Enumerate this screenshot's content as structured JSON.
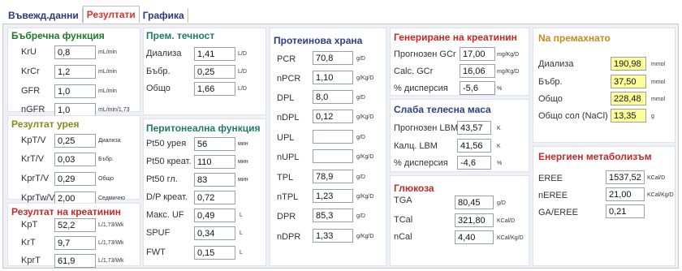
{
  "tabs": {
    "entry": "Въвежд.данни",
    "results": "Резултати",
    "graphics": "Графика"
  },
  "kidney": {
    "title": "Бъбречна функция",
    "rows": [
      {
        "label": "KrU",
        "value": "0,8",
        "unit": "mL/min"
      },
      {
        "label": "KrCr",
        "value": "1,2",
        "unit": "mL/min"
      },
      {
        "label": "GFR",
        "value": "1,0",
        "unit": "mL/min"
      },
      {
        "label": "nGFR",
        "value": "1,0",
        "unit": "mL/min/1,73"
      }
    ]
  },
  "urea": {
    "title": "Резултат урея",
    "rows": [
      {
        "label": "KpT/V",
        "value": "0,25",
        "unit": "Диализа"
      },
      {
        "label": "KrT/V",
        "value": "0,03",
        "unit": "Бъбр."
      },
      {
        "label": "KprT/V",
        "value": "0,29",
        "unit": "Общо"
      },
      {
        "label": "KprTw/V",
        "value": "2,00",
        "unit": "Седмично"
      }
    ]
  },
  "creat": {
    "title": "Резултат на креатинин",
    "rows": [
      {
        "label": "KpT",
        "value": "52,2",
        "unit": "L/1,73/Wk"
      },
      {
        "label": "KrT",
        "value": "9,7",
        "unit": "L/1,73/Wk"
      },
      {
        "label": "KprT",
        "value": "61,9",
        "unit": "L/1,73/Wk"
      }
    ]
  },
  "fluid": {
    "title": "Прем. течност",
    "rows": [
      {
        "label": "Диализа",
        "value": "1,41",
        "unit": "L/D"
      },
      {
        "label": "Бъбр.",
        "value": "0,25",
        "unit": "L/D"
      },
      {
        "label": "Общо",
        "value": "1,66",
        "unit": "L/D"
      }
    ]
  },
  "peritoneal": {
    "title": "Перитонеална функция",
    "rows": [
      {
        "label": "Pt50 урея",
        "value": "56",
        "unit": "мин"
      },
      {
        "label": "Pt50 креат.",
        "value": "110",
        "unit": "мин"
      },
      {
        "label": "Pt50 гл.",
        "value": "83",
        "unit": "мин"
      },
      {
        "label": "D/P креат.",
        "value": "0,72",
        "unit": ""
      },
      {
        "label": "Макс. UF",
        "value": "0,49",
        "unit": "L"
      },
      {
        "label": "SPUF",
        "value": "0,34",
        "unit": "L"
      },
      {
        "label": "FWT",
        "value": "0,15",
        "unit": "L"
      }
    ]
  },
  "protein": {
    "title": "Протеинова храна",
    "rows": [
      {
        "label": "PCR",
        "value": "70,8",
        "unit": "g/D"
      },
      {
        "label": "nPCR",
        "value": "1,10",
        "unit": "g/Kg/D"
      },
      {
        "label": "DPL",
        "value": "8,0",
        "unit": "g/D"
      },
      {
        "label": "nDPL",
        "value": "0,12",
        "unit": "g/Kg/D"
      },
      {
        "label": "UPL",
        "value": "",
        "unit": "g/D"
      },
      {
        "label": "nUPL",
        "value": "",
        "unit": "g/Kg/D"
      },
      {
        "label": "TPL",
        "value": "78,9",
        "unit": "g/D"
      },
      {
        "label": "nTPL",
        "value": "1,23",
        "unit": "g/Kg/D"
      },
      {
        "label": "DPR",
        "value": "85,3",
        "unit": "g/D"
      },
      {
        "label": "nDPR",
        "value": "1,33",
        "unit": "g/Kg/D"
      }
    ]
  },
  "creatgen": {
    "title": "Генериране на креатинин",
    "rows": [
      {
        "label": "Прогнозен GCr",
        "value": "17,00",
        "unit": "mg/Kg/D"
      },
      {
        "label": "Calc. GCr",
        "value": "16,06",
        "unit": "mg/Kg/D"
      },
      {
        "label": "% дисперсия",
        "value": "-5,6",
        "unit": "%"
      }
    ]
  },
  "lbm": {
    "title": "Слаба телесна маса",
    "rows": [
      {
        "label": "Прогнозен LBM",
        "value": "43,57",
        "unit": "K"
      },
      {
        "label": "Калц. LBM",
        "value": "41,56",
        "unit": "K"
      },
      {
        "label": "% дисперсия",
        "value": "-4,6",
        "unit": "%"
      }
    ]
  },
  "glucose": {
    "title": "Глюкоза",
    "rows": [
      {
        "label": "TGA",
        "value": "80,45",
        "unit": "g/D"
      },
      {
        "label": "TCal",
        "value": "321,80",
        "unit": "KCal/D"
      },
      {
        "label": "nCal",
        "value": "4,40",
        "unit": "KCal/Kg/D"
      }
    ]
  },
  "removed": {
    "title": "Na премахнато",
    "rows": [
      {
        "label": "Диализа",
        "value": "190,98",
        "unit": "mmol"
      },
      {
        "label": "Бъбр.",
        "value": "37,50",
        "unit": "mmol"
      },
      {
        "label": "Общо",
        "value": "228,48",
        "unit": "mmol"
      },
      {
        "label": "Общо сол (NaCl)",
        "value": "13,35",
        "unit": "g"
      }
    ]
  },
  "energy": {
    "title": "Енергиен метаболизъм",
    "rows": [
      {
        "label": "EREE",
        "value": "1537,52",
        "unit": "KCal/D"
      },
      {
        "label": "nEREE",
        "value": "21,00",
        "unit": "KCal/Kg/D"
      },
      {
        "label": "GA/EREE",
        "value": "0,21",
        "unit": ""
      }
    ]
  }
}
